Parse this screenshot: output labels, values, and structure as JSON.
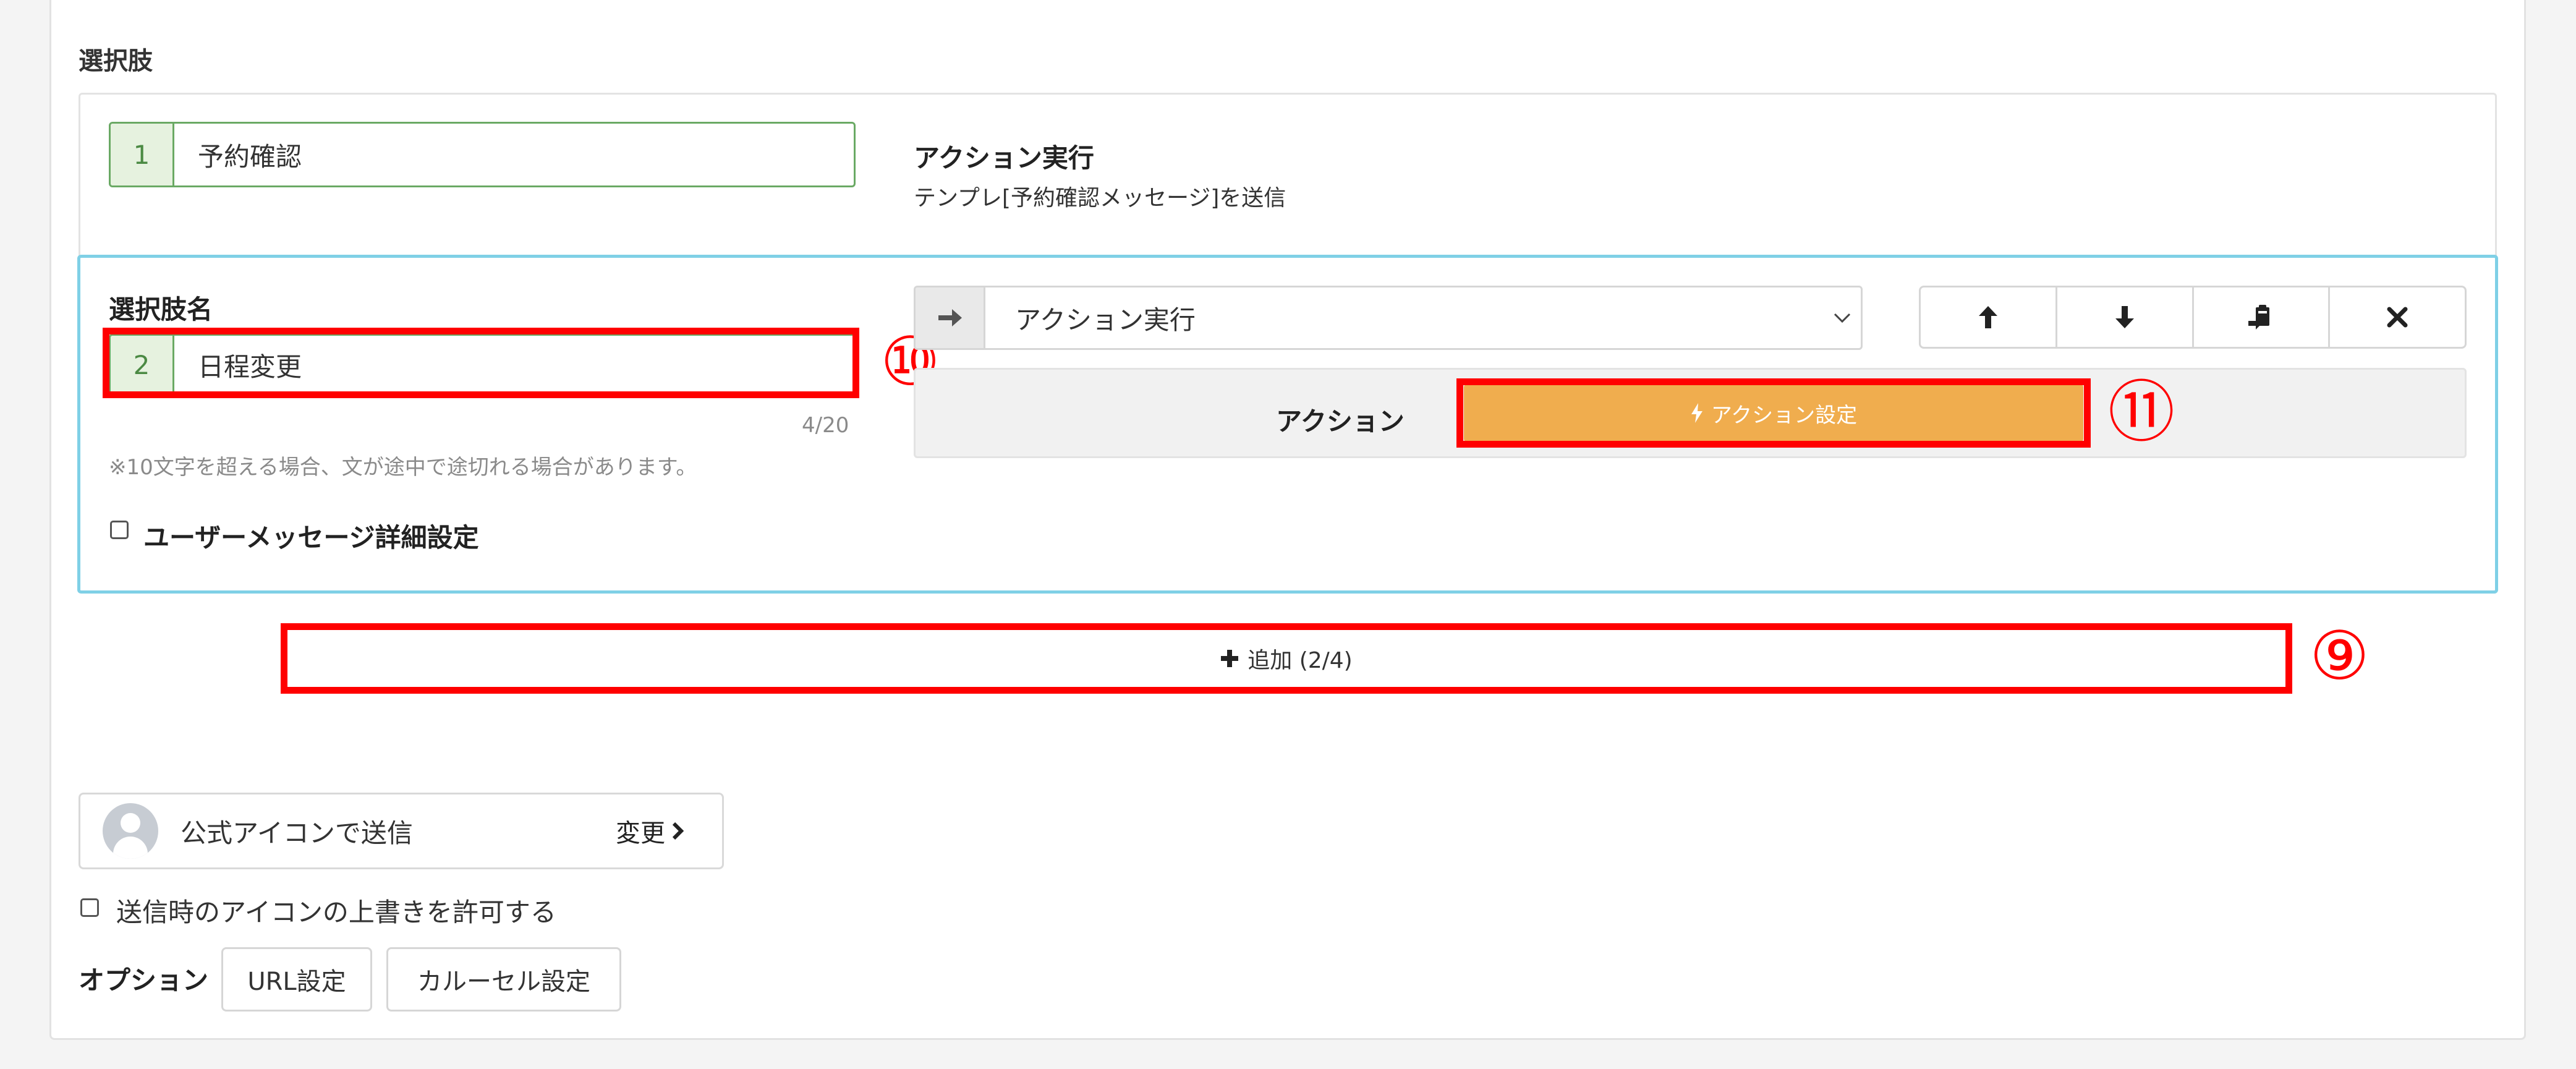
{
  "section": {
    "label": "選択肢"
  },
  "choice1": {
    "number": "1",
    "value": "予約確認",
    "action_title": "アクション実行",
    "action_desc": "テンプレ[予約確認メッセージ]を送信"
  },
  "choice2": {
    "name_label": "選択肢名",
    "number": "2",
    "value": "日程変更",
    "counter": "4/20",
    "note": "※10文字を超える場合、文が途中で途切れる場合があります。",
    "detail_checkbox_label": "ユーザーメッセージ詳細設定",
    "select_value": "アクション実行",
    "action_label": "アクション",
    "action_button": "アクション設定"
  },
  "add_button": {
    "label": "追加 (2/4)"
  },
  "annotations": {
    "n9": "⑨",
    "n10": "⑩",
    "n11": "⑪"
  },
  "sender": {
    "label": "公式アイコンで送信",
    "change": "変更"
  },
  "override_checkbox_label": "送信時のアイコンの上書きを許可する",
  "options": {
    "label": "オプション",
    "url_button": "URL設定",
    "carousel_button": "カルーセル設定"
  },
  "colors": {
    "accent_green": "#6aa964",
    "active_border": "#7fd0e6",
    "action_orange": "#f0ad4e",
    "annotation_red": "#ff0000"
  },
  "icons": [
    "arrow-right-icon",
    "chevron-down-icon",
    "arrow-up-icon",
    "arrow-down-icon",
    "paste-icon",
    "close-icon",
    "bolt-icon",
    "plus-icon",
    "chevron-right-icon",
    "avatar-icon"
  ]
}
